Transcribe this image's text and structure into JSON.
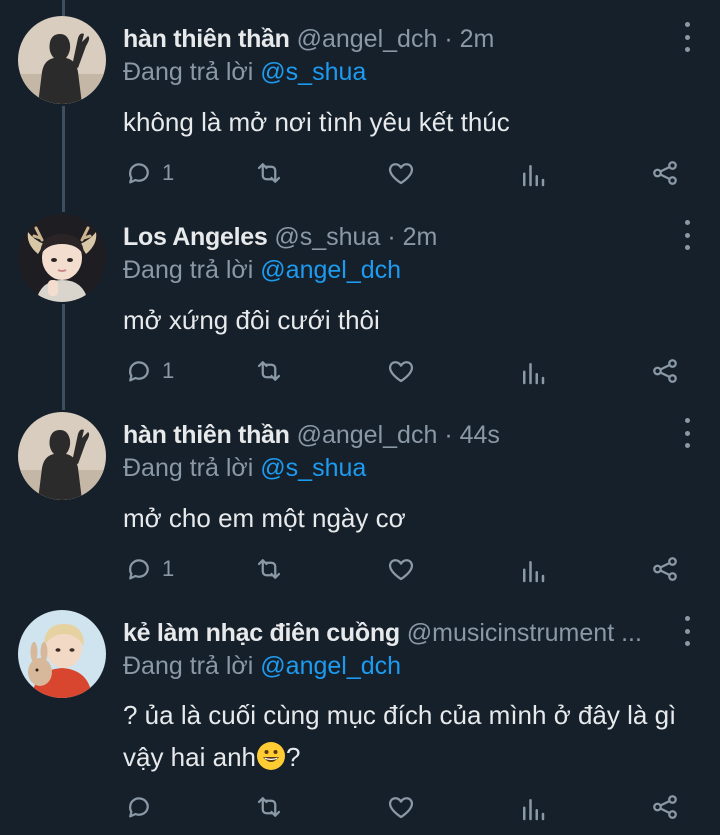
{
  "tweets": [
    {
      "name": "hàn thiên thần",
      "handle": "@angel_dch",
      "time": "· 2m",
      "reply_prefix": "Đang trả lời",
      "reply_to": "@s_shua",
      "text": "không là mở nơi tình yêu kết thúc",
      "reply_count": "1",
      "avatar": "avatar-silhouette"
    },
    {
      "name": "Los Angeles",
      "handle": "@s_shua",
      "time": "· 2m",
      "reply_prefix": "Đang trả lời",
      "reply_to": "@angel_dch",
      "text": "mở xứng đôi cưới thôi",
      "reply_count": "1",
      "avatar": "avatar-deer-ears"
    },
    {
      "name": "hàn thiên thần",
      "handle": "@angel_dch",
      "time": "· 44s",
      "reply_prefix": "Đang trả lời",
      "reply_to": "@s_shua",
      "text": "mở cho em một ngày cơ",
      "reply_count": "1",
      "avatar": "avatar-silhouette"
    },
    {
      "name": "kẻ làm nhạc điên cuồng",
      "handle": "@musicinstrument ...",
      "time": "",
      "reply_prefix": "Đang trả lời",
      "reply_to": "@angel_dch",
      "text_line1": "? ủa là cuối cùng mục đích của mình ở đây là gì",
      "text_line2_a": "vậy hai anh",
      "text_line2_b": "?",
      "reply_count": "",
      "avatar": "avatar-bunny"
    }
  ],
  "icons": {
    "reply": "reply-icon",
    "retweet": "retweet-icon",
    "like": "heart-icon",
    "views": "views-icon",
    "share": "share-icon",
    "menu": "more-icon",
    "emoji": "grinning-face-emoji"
  },
  "colors": {
    "background": "#15202b",
    "text": "#e7e9ea",
    "secondary": "#8b98a5",
    "mention": "#1d9bf0",
    "thread_line": "#3d4f5f"
  }
}
